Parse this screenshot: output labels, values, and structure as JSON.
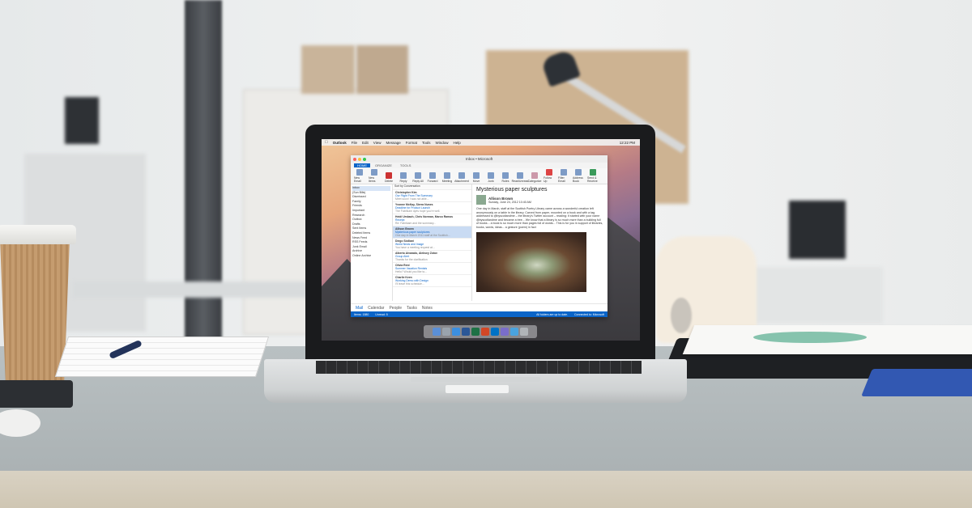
{
  "menubar": {
    "app": "Outlook",
    "items": [
      "File",
      "Edit",
      "View",
      "Message",
      "Format",
      "Tools",
      "Window",
      "Help"
    ],
    "clock": "12:22 PM"
  },
  "window": {
    "title": "Inbox • Microsoft",
    "tabs": [
      "HOME",
      "ORGANIZE",
      "TOOLS"
    ],
    "ribbon": [
      "New Email",
      "New Items",
      "Delete",
      "Reply",
      "Reply All",
      "Forward",
      "Meeting",
      "Attachment",
      "Move",
      "Junk",
      "Rules",
      "Read/Unread",
      "Categorize",
      "Follow Up",
      "Filter Email",
      "Address Book",
      "Send & Receive"
    ],
    "folders": [
      "Inbox",
      "(Sun Bills)",
      "Dismissed",
      "Family",
      "Friends",
      "Important",
      "Research",
      "Outbox",
      "Drafts",
      "Sent Items",
      "Deleted Items",
      "News Feed",
      "RSS Feeds",
      "Junk Email",
      "Archive",
      "Online Archive"
    ],
    "list_header": "Sort by Conversation",
    "messages": [
      {
        "from": "Christopher Kim",
        "subject": "Our Flight From The Summary",
        "preview": "Meet soon! I was not able..."
      },
      {
        "from": "Yvonne McKay, Sierra Nunes",
        "subject": "Deadline for Product Launch",
        "preview": "The Fabrikam dyes hope you're well."
      },
      {
        "from": "Heidi Umbach, Chris Norman, Marco Ramos",
        "subject": "Receipt",
        "preview": "Re: Fabrikam and the summary..."
      },
      {
        "from": "Allison Brown",
        "subject": "Mysterious paper sculptures",
        "preview": "One day in March 2011 staff at the Scottish..."
      },
      {
        "from": "Diego Siciliani",
        "subject": "World News and Image",
        "preview": "You have a meeting request at..."
      },
      {
        "from": "Alberto Alvarado, Aleksey Zotov",
        "subject": "Group Alert",
        "preview": "Thanks for the clarification"
      },
      {
        "from": "Olivia Reid",
        "subject": "Summer Vacation Rentals",
        "preview": "Hello? Would you like to..."
      },
      {
        "from": "Charlie Keen",
        "subject": "Working Demo with Design",
        "preview": "I'll leave this schedule..."
      }
    ],
    "reading": {
      "heading": "Mysterious paper sculptures",
      "sender": "Allison Brown",
      "meta": "Sunday, June 24, 2012 10:40 AM",
      "body": "One day in March, staff at the Scottish Poetry Library came across a wonderful creation left anonymously on a table in the library. Carved from paper, mounted on a book and with a tag addressed to @byscotlandme – the library's Twitter account – reading: It started with your name @byscotlandme and became a tree... We know that a library is so much more than a building full of books... a book is so much more than pages full of words... This is for you in support of libraries, books, words, ideas... a gesture (poem) in fact"
    },
    "navbar": [
      "Mail",
      "Calendar",
      "People",
      "Tasks",
      "Notes"
    ],
    "status_left": "Items: 1580",
    "status_unread": "Unread: 5",
    "status_mid": "All folders are up to date.",
    "status_right": "Connected to: Microsoft"
  },
  "colors": {
    "accent": "#0a64c8",
    "desk": "#aeb5b7"
  }
}
